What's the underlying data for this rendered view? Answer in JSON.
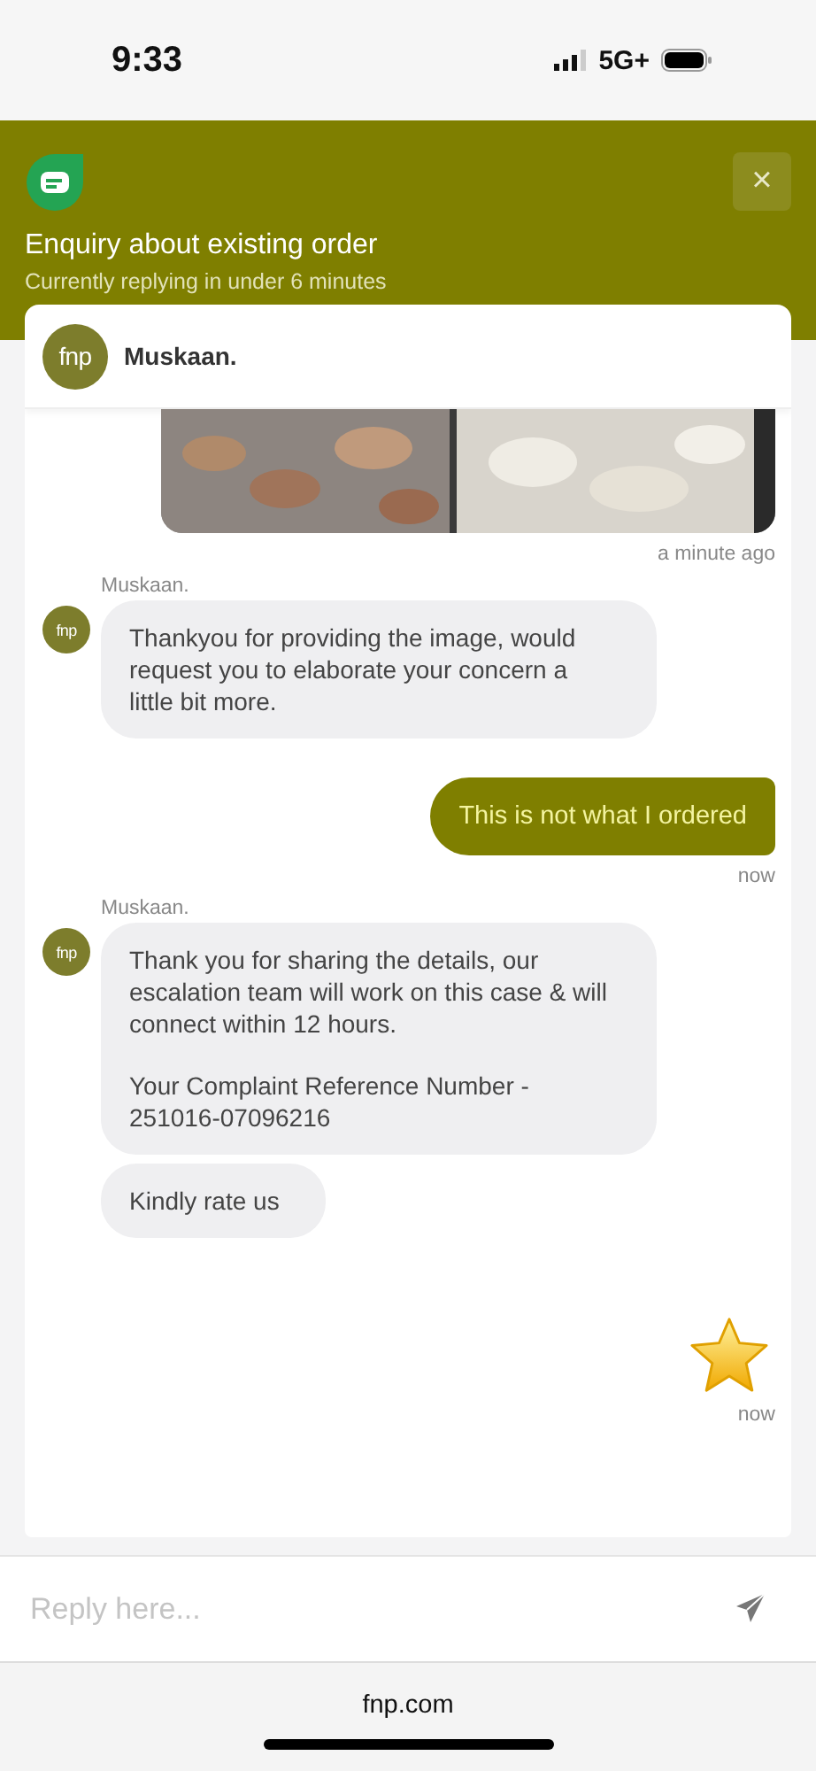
{
  "status_bar": {
    "time": "9:33",
    "network": "5G+"
  },
  "header": {
    "title": "Enquiry about existing order",
    "subtitle": "Currently replying in under 6 minutes",
    "close": "×"
  },
  "agent": {
    "name": "Muskaan.",
    "avatar": "fnp"
  },
  "messages": [
    {
      "time": "a minute ago"
    },
    {
      "kind": "agent",
      "sender": "Muskaan.",
      "avatar": "fnp",
      "bubbles": [
        [
          "Thankyou for providing the image, would request you to elaborate your concern a little bit more."
        ]
      ]
    },
    {
      "kind": "user",
      "text": "This is not what I ordered",
      "time": "now"
    },
    {
      "kind": "agent",
      "sender": "Muskaan.",
      "avatar": "fnp",
      "bubbles": [
        [
          "Thank you for sharing the details, our escalation team will work on this case & will connect within 12 hours.",
          "Your Complaint Reference Number - 251016-07096216"
        ],
        [
          "Kindly rate us"
        ]
      ]
    },
    {
      "kind": "star",
      "time": "now"
    }
  ],
  "composer": {
    "placeholder": "Reply here..."
  },
  "browser": {
    "url": "fnp.com"
  }
}
